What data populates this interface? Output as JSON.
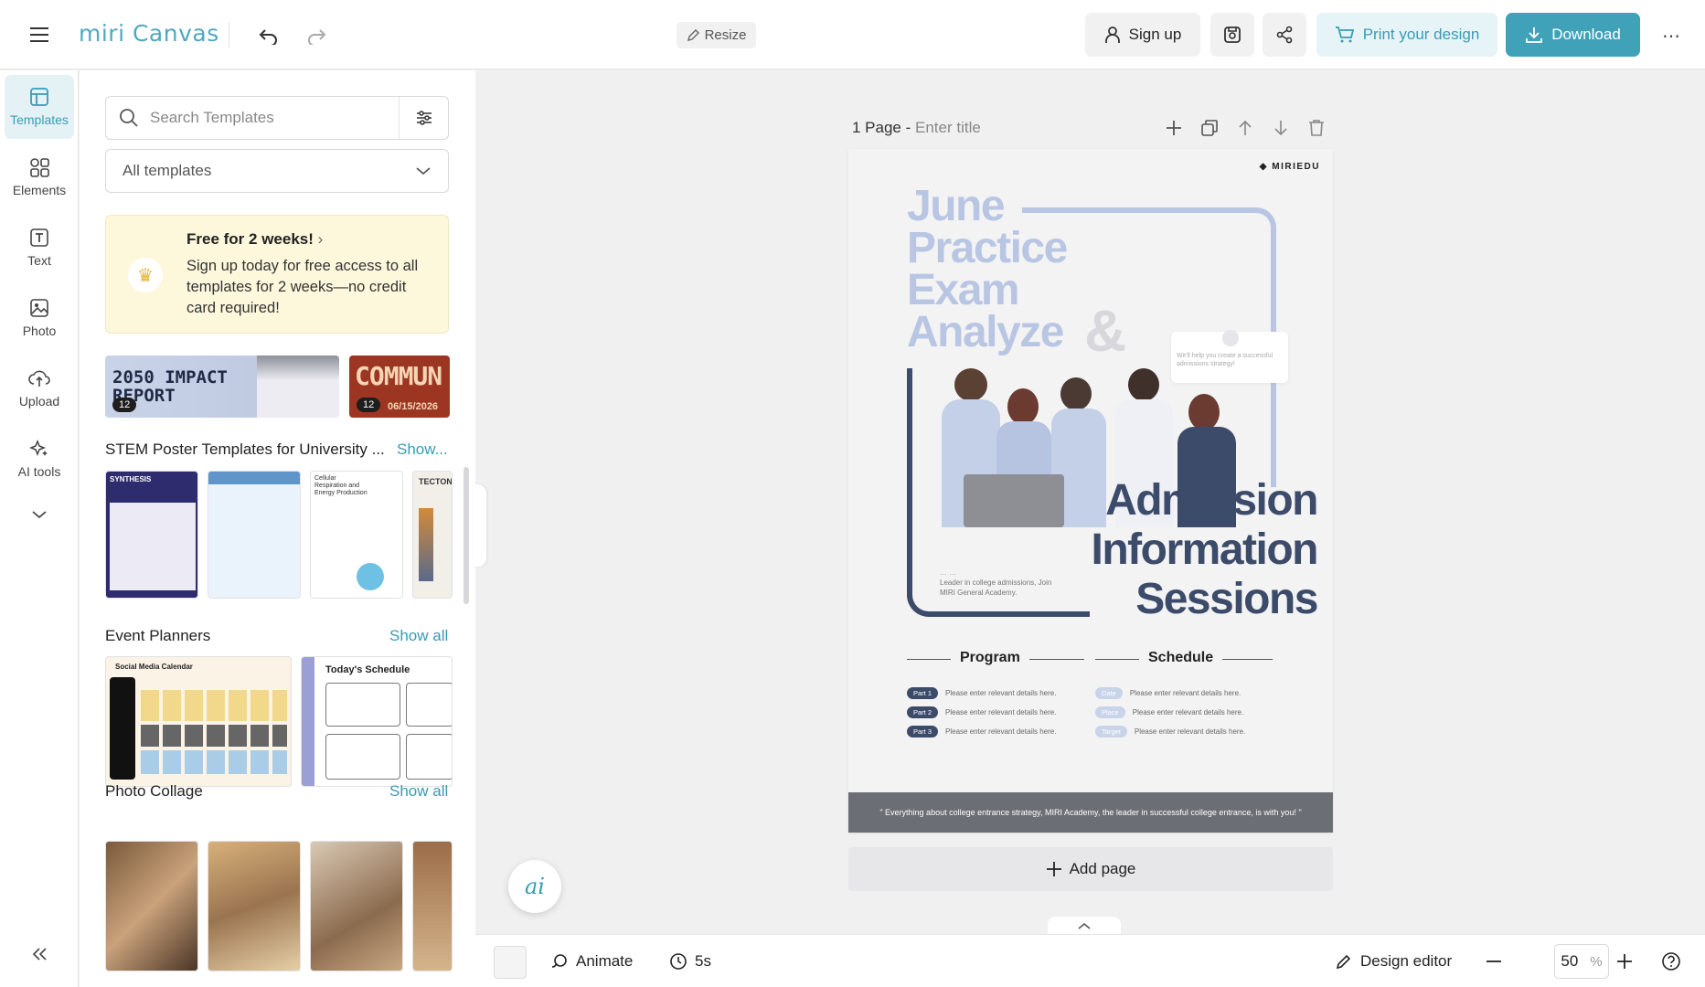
{
  "header": {
    "logo": "miri Canvas",
    "resize_label": "Resize",
    "signup_label": "Sign up",
    "print_label": "Print your design",
    "download_label": "Download"
  },
  "rail": {
    "items": [
      {
        "label": "Templates",
        "icon": "templates-icon"
      },
      {
        "label": "Elements",
        "icon": "elements-icon"
      },
      {
        "label": "Text",
        "icon": "text-icon"
      },
      {
        "label": "Photo",
        "icon": "photo-icon"
      },
      {
        "label": "Upload",
        "icon": "upload-icon"
      },
      {
        "label": "AI tools",
        "icon": "ai-tools-icon"
      }
    ]
  },
  "panel": {
    "search_placeholder": "Search Templates",
    "filter_value": "All templates",
    "promo_title": "Free for 2 weeks!",
    "promo_body": "Sign up today for free access to all templates for 2 weeks—no credit card required!",
    "banners": [
      {
        "text": "2050 IMPACT REPORT",
        "count": "12"
      },
      {
        "text": "COMMUN",
        "date": "06/15/2026",
        "count": "12"
      }
    ],
    "sections": [
      {
        "title": "STEM Poster Templates for University ...",
        "show": "Show..."
      },
      {
        "title": "Event Planners",
        "show": "Show all"
      },
      {
        "title": "Photo Collage",
        "show": "Show all"
      }
    ],
    "stem_thumbs": [
      "SYNTHESIS",
      "",
      "Cellular Respiration and Energy Production",
      "TECTON"
    ],
    "event_thumbs": [
      "Social Media Calendar",
      "Today's Schedule"
    ]
  },
  "canvas": {
    "page_label": "1 Page - ",
    "page_title_placeholder": "Enter title",
    "add_page_label": "Add page"
  },
  "poster": {
    "brand": "MIRIEDU",
    "title_lines": [
      "June",
      "Practice",
      "Exam",
      "Analyze"
    ],
    "ampersand": "&",
    "bubble": "We'll help you create a successful admissions strategy!",
    "headline_lines": [
      "Admission",
      "Information",
      "Sessions"
    ],
    "tagline": "Leader in college admissions, Join MIRI General Academy.",
    "program_heading": "Program",
    "schedule_heading": "Schedule",
    "program_rows": [
      {
        "tag": "Part 1",
        "text": "Please enter relevant details here."
      },
      {
        "tag": "Part 2",
        "text": "Please enter relevant details here."
      },
      {
        "tag": "Part 3",
        "text": "Please enter relevant details here."
      }
    ],
    "schedule_rows": [
      {
        "tag": "Date",
        "text": "Please enter relevant details here."
      },
      {
        "tag": "Place",
        "text": "Please enter relevant details here."
      },
      {
        "tag": "Target",
        "text": "Please enter relevant details here."
      }
    ],
    "footer_quote": "\" Everything about college entrance strategy, MIRI Academy, the leader in successful college entrance, is with you! \""
  },
  "bottom": {
    "animate_label": "Animate",
    "duration_label": "5s",
    "design_editor_label": "Design editor",
    "zoom_value": "50",
    "zoom_unit": "%"
  },
  "fab": {
    "label": "ai"
  },
  "colors": {
    "accent": "#3fa2b9",
    "poster_navy": "#3d4b6a",
    "poster_light": "#b9c6e3"
  }
}
